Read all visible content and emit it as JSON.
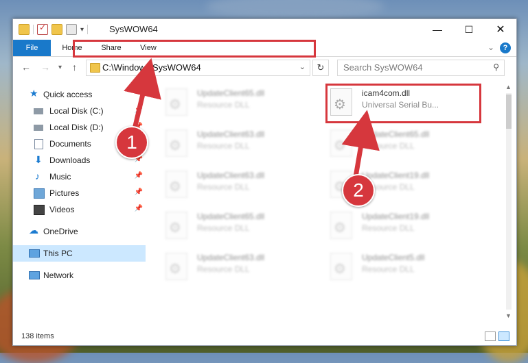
{
  "window": {
    "title": "SysWOW64",
    "controls": {
      "minimize": "—",
      "maximize": "☐",
      "close": "✕"
    }
  },
  "ribbon": {
    "tabs": [
      "File",
      "Home",
      "Share",
      "View"
    ]
  },
  "nav": {
    "address": "C:\\Windows\\SysWOW64",
    "search_placeholder": "Search SysWOW64"
  },
  "sidebar": {
    "items": [
      {
        "label": "Quick access",
        "icon": "star-icon",
        "pinned": false
      },
      {
        "label": "Local Disk (C:)",
        "icon": "drive-icon",
        "pinned": true
      },
      {
        "label": "Local Disk (D:)",
        "icon": "drive-icon",
        "pinned": true
      },
      {
        "label": "Documents",
        "icon": "document-icon",
        "pinned": true
      },
      {
        "label": "Downloads",
        "icon": "download-icon",
        "pinned": true
      },
      {
        "label": "Music",
        "icon": "music-icon",
        "pinned": true
      },
      {
        "label": "Pictures",
        "icon": "picture-icon",
        "pinned": true
      },
      {
        "label": "Videos",
        "icon": "video-icon",
        "pinned": true
      },
      {
        "label": "OneDrive",
        "icon": "cloud-icon",
        "pinned": false
      },
      {
        "label": "This PC",
        "icon": "computer-icon",
        "pinned": false,
        "selected": true
      },
      {
        "label": "Network",
        "icon": "network-icon",
        "pinned": false
      }
    ]
  },
  "files": [
    {
      "name": "UpdateClient65.dll",
      "type": "Resource DLL",
      "blurred": true
    },
    {
      "name": "icam4com.dll",
      "type": "Universal Serial Bu...",
      "blurred": false
    },
    {
      "name": "UpdateClient63.dll",
      "type": "Resource DLL",
      "blurred": true
    },
    {
      "name": "UpdateClient65.dll",
      "type": "Resource DLL",
      "blurred": true
    },
    {
      "name": "UpdateClient63.dll",
      "type": "Resource DLL",
      "blurred": true
    },
    {
      "name": "UpdateClient19.dll",
      "type": "Resource DLL",
      "blurred": true
    },
    {
      "name": "UpdateClient65.dll",
      "type": "Resource DLL",
      "blurred": true
    },
    {
      "name": "UpdateClient19.dll",
      "type": "Resource DLL",
      "blurred": true
    },
    {
      "name": "UpdateClient63.dll",
      "type": "Resource DLL",
      "blurred": true
    },
    {
      "name": "UpdateClient5.dll",
      "type": "Resource DLL",
      "blurred": true
    }
  ],
  "status": {
    "item_count": "138 items"
  },
  "annotations": {
    "marker_1": "1",
    "marker_2": "2",
    "color": "#d6373d"
  }
}
